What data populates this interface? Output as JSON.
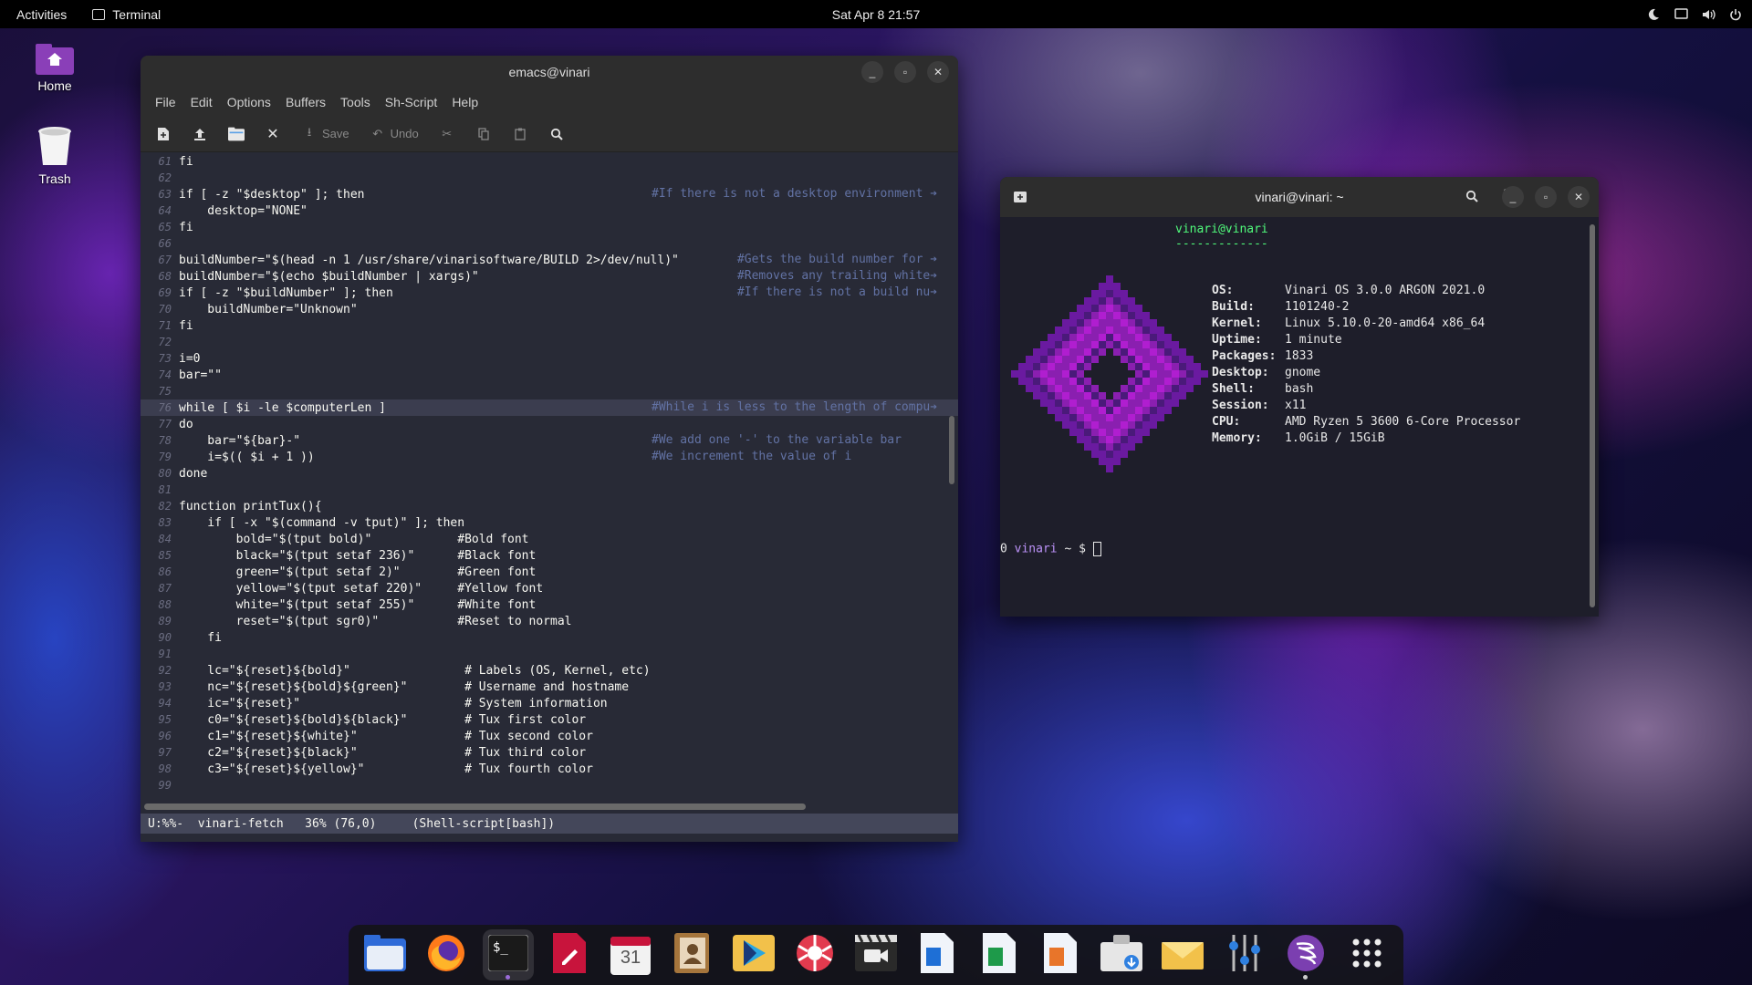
{
  "topbar": {
    "activities": "Activities",
    "app_name": "Terminal",
    "clock": "Sat Apr 8  21:57"
  },
  "desktop": {
    "home_label": "Home",
    "trash_label": "Trash"
  },
  "emacs": {
    "title": "emacs@vinari",
    "menu": [
      "File",
      "Edit",
      "Options",
      "Buffers",
      "Tools",
      "Sh-Script",
      "Help"
    ],
    "toolbar": {
      "save": "Save",
      "undo": "Undo"
    },
    "lines": [
      {
        "n": "61",
        "t": "fi",
        "c": ""
      },
      {
        "n": "62",
        "t": "",
        "c": ""
      },
      {
        "n": "63",
        "t": "if [ -z \"$desktop\" ]; then",
        "c": "#If there is not a desktop environment ➔"
      },
      {
        "n": "64",
        "t": "    desktop=\"NONE\"",
        "c": ""
      },
      {
        "n": "65",
        "t": "fi",
        "c": ""
      },
      {
        "n": "66",
        "t": "",
        "c": ""
      },
      {
        "n": "67",
        "t": "buildNumber=\"$(head -n 1 /usr/share/vinarisoftware/BUILD 2>/dev/null)\"",
        "c": "            #Gets the build number for ➔"
      },
      {
        "n": "68",
        "t": "buildNumber=\"$(echo $buildNumber | xargs)\"",
        "c": "            #Removes any trailing white➔"
      },
      {
        "n": "69",
        "t": "if [ -z \"$buildNumber\" ]; then",
        "c": "            #If there is not a build nu➔"
      },
      {
        "n": "70",
        "t": "    buildNumber=\"Unknown\"",
        "c": ""
      },
      {
        "n": "71",
        "t": "fi",
        "c": ""
      },
      {
        "n": "72",
        "t": "",
        "c": ""
      },
      {
        "n": "73",
        "t": "i=0",
        "c": ""
      },
      {
        "n": "74",
        "t": "bar=\"\"",
        "c": ""
      },
      {
        "n": "75",
        "t": "",
        "c": ""
      },
      {
        "n": "76",
        "t": "while [ $i -le $computerLen ]",
        "c": "#While i is less to the length of compu➔"
      },
      {
        "n": "77",
        "t": "do",
        "c": ""
      },
      {
        "n": "78",
        "t": "    bar=\"${bar}-\"",
        "c": "#We add one '-' to the variable bar"
      },
      {
        "n": "79",
        "t": "    i=$(( $i + 1 ))",
        "c": "#We increment the value of i"
      },
      {
        "n": "80",
        "t": "done",
        "c": ""
      },
      {
        "n": "81",
        "t": "",
        "c": ""
      },
      {
        "n": "82",
        "t": "function printTux(){",
        "c": ""
      },
      {
        "n": "83",
        "t": "    if [ -x \"$(command -v tput)\" ]; then",
        "c": ""
      },
      {
        "n": "84",
        "t": "        bold=\"$(tput bold)\"            #Bold font",
        "c": ""
      },
      {
        "n": "85",
        "t": "        black=\"$(tput setaf 236)\"      #Black font",
        "c": ""
      },
      {
        "n": "86",
        "t": "        green=\"$(tput setaf 2)\"        #Green font",
        "c": ""
      },
      {
        "n": "87",
        "t": "        yellow=\"$(tput setaf 220)\"     #Yellow font",
        "c": ""
      },
      {
        "n": "88",
        "t": "        white=\"$(tput setaf 255)\"      #White font",
        "c": ""
      },
      {
        "n": "89",
        "t": "        reset=\"$(tput sgr0)\"           #Reset to normal",
        "c": ""
      },
      {
        "n": "90",
        "t": "    fi",
        "c": ""
      },
      {
        "n": "91",
        "t": "",
        "c": ""
      },
      {
        "n": "92",
        "t": "    lc=\"${reset}${bold}\"                # Labels (OS, Kernel, etc)",
        "c": ""
      },
      {
        "n": "93",
        "t": "    nc=\"${reset}${bold}${green}\"        # Username and hostname",
        "c": ""
      },
      {
        "n": "94",
        "t": "    ic=\"${reset}\"                       # System information",
        "c": ""
      },
      {
        "n": "95",
        "t": "    c0=\"${reset}${bold}${black}\"        # Tux first color",
        "c": ""
      },
      {
        "n": "96",
        "t": "    c1=\"${reset}${white}\"               # Tux second color",
        "c": ""
      },
      {
        "n": "97",
        "t": "    c2=\"${reset}${black}\"               # Tux third color",
        "c": ""
      },
      {
        "n": "98",
        "t": "    c3=\"${reset}${yellow}\"              # Tux fourth color",
        "c": ""
      },
      {
        "n": "99",
        "t": "",
        "c": ""
      }
    ],
    "modeline": "U:%%-  vinari-fetch   36% (76,0)     (Shell-script[bash])"
  },
  "terminal": {
    "title": "vinari@vinari: ~",
    "user_host": "vinari@vinari",
    "separator": "-------------",
    "info": [
      {
        "k": "OS:",
        "v": "Vinari OS 3.0.0 ARGON 2021.0"
      },
      {
        "k": "Build:",
        "v": "1101240-2"
      },
      {
        "k": "Kernel:",
        "v": "Linux 5.10.0-20-amd64 x86_64"
      },
      {
        "k": "Uptime:",
        "v": "1 minute"
      },
      {
        "k": "Packages:",
        "v": "1833"
      },
      {
        "k": "Desktop:",
        "v": "gnome"
      },
      {
        "k": "Shell:",
        "v": "bash"
      },
      {
        "k": "Session:",
        "v": "x11"
      },
      {
        "k": "CPU:",
        "v": "AMD Ryzen 5 3600 6-Core Processor"
      },
      {
        "k": "Memory:",
        "v": "1.0GiB / 15GiB"
      }
    ],
    "prompt_status": "0",
    "prompt_host": "vinari",
    "prompt_path": "~ $"
  },
  "dock": {
    "items": [
      "files-icon",
      "firefox-icon",
      "terminal-icon",
      "text-editor-icon",
      "calendar-icon",
      "contacts-icon",
      "software-center-icon",
      "shutter-icon",
      "video-icon",
      "writer-icon",
      "calc-icon",
      "impress-icon",
      "archive-manager-icon",
      "mail-icon",
      "settings-icon",
      "emacs-icon",
      "app-grid-icon"
    ],
    "calendar_day": "31"
  },
  "colors": {
    "accent": "#9b6bd8",
    "keyword": "#ff79c6",
    "comment": "#6272a4",
    "prompt_green": "#50fa7b"
  }
}
